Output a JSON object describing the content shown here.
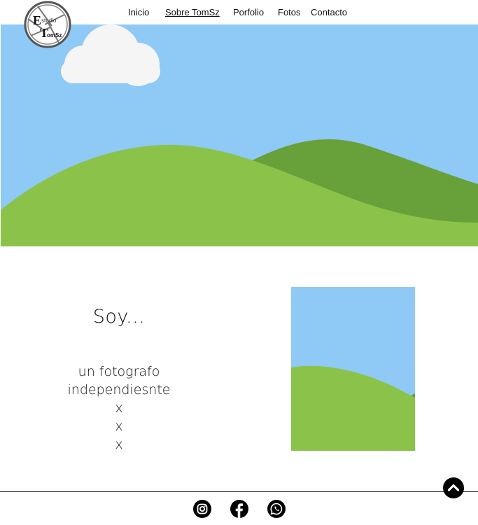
{
  "logo": {
    "big_letter_1": "E",
    "small_text_1": "studio",
    "big_letter_2": "T",
    "small_text_2": "omSz"
  },
  "nav": {
    "items": [
      {
        "label": "Inicio"
      },
      {
        "label": "Sobre TomSz",
        "active": true
      },
      {
        "label": "Porfolio"
      },
      {
        "label": "Fotos"
      },
      {
        "label": "Contacto"
      }
    ]
  },
  "hero": {
    "image": "landscape-placeholder",
    "colors": {
      "sky": "#8fc9f6",
      "hill_light": "#8bc34a",
      "hill_dark": "#68a03a",
      "cloud": "#f5f5f5"
    }
  },
  "about": {
    "heading": "Soy...",
    "lines": [
      "un fotografo",
      "independiesnte",
      "x",
      "x",
      "x"
    ]
  },
  "portrait": {
    "image": "landscape-placeholder"
  },
  "footer": {
    "icons": [
      "instagram-icon",
      "facebook-icon",
      "whatsapp-icon"
    ]
  },
  "back_to_top": {
    "icon": "chevron-up-icon"
  }
}
